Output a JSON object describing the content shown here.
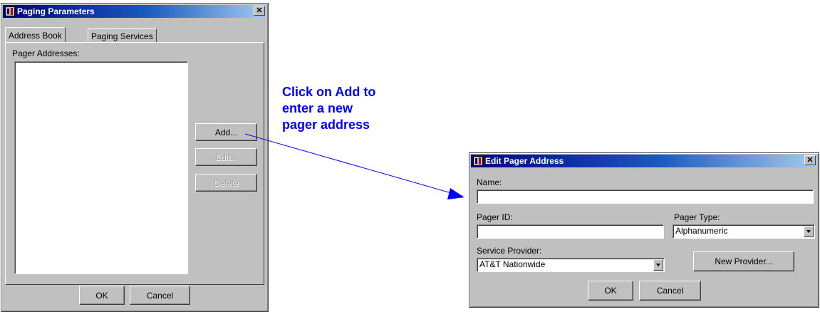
{
  "paging_window": {
    "title": "Paging Parameters",
    "close_glyph": "✕",
    "tabs": [
      {
        "label": "Address Book"
      },
      {
        "label": "Paging Services"
      }
    ],
    "list_label": "Pager Addresses:",
    "buttons": {
      "add": "Add...",
      "edit": "Edit...",
      "delete": "Delete"
    },
    "ok": "OK",
    "cancel": "Cancel"
  },
  "annotation": {
    "lines": [
      "Click on Add to",
      "enter a new",
      "pager address"
    ],
    "color": "#0000ff"
  },
  "edit_window": {
    "title": "Edit Pager Address",
    "close_glyph": "✕",
    "name_label": "Name:",
    "name_value": "",
    "pager_id_label": "Pager ID:",
    "pager_id_value": "",
    "pager_type_label": "Pager Type:",
    "pager_type_value": "Alphanumeric",
    "service_provider_label": "Service Provider:",
    "service_provider_value": "AT&T Nationwide",
    "new_provider": "New Provider...",
    "ok": "OK",
    "cancel": "Cancel"
  },
  "colors": {
    "title_gradient_start": "#000080",
    "title_gradient_end": "#a6caf0",
    "face": "#c0c0c0"
  }
}
